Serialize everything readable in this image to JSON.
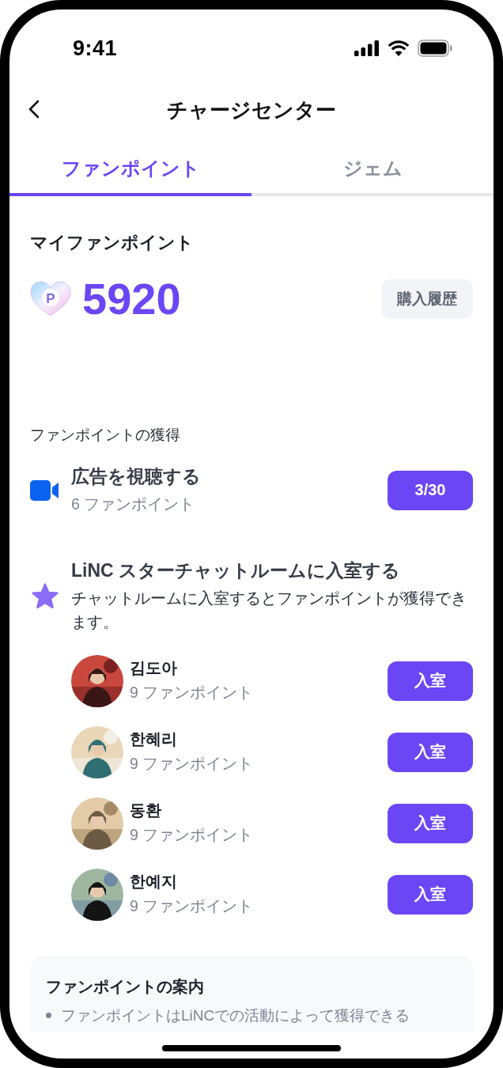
{
  "status_bar": {
    "time": "9:41"
  },
  "header": {
    "title": "チャージセンター"
  },
  "tabs": [
    {
      "label": "ファンポイント",
      "selected": true
    },
    {
      "label": "ジェム",
      "selected": false
    }
  ],
  "balance": {
    "title": "マイファンポイント",
    "badge": "P",
    "amount": "5920",
    "history_button": "購入履歴"
  },
  "earn": {
    "title": "ファンポイントの獲得",
    "tasks": [
      {
        "kind": "video",
        "title": "広告を視聴する",
        "subtitle": "6 ファンポイント",
        "button": "3/30"
      },
      {
        "kind": "star",
        "title": "LiNC スターチャットルームに入室する",
        "subtitle": "チャットルームに入室するとファンポイントが獲得できます。",
        "rooms": [
          {
            "name": "김도아",
            "points": "9 ファンポイント",
            "button": "入室"
          },
          {
            "name": "한혜리",
            "points": "9 ファンポイント",
            "button": "入室"
          },
          {
            "name": "동환",
            "points": "9 ファンポイント",
            "button": "入室"
          },
          {
            "name": "한예지",
            "points": "9 ファンポイント",
            "button": "入室"
          }
        ]
      }
    ]
  },
  "info": {
    "title": "ファンポイントの案内",
    "items": [
      "ファンポイントはLiNCでの活動によって獲得できる"
    ]
  }
}
